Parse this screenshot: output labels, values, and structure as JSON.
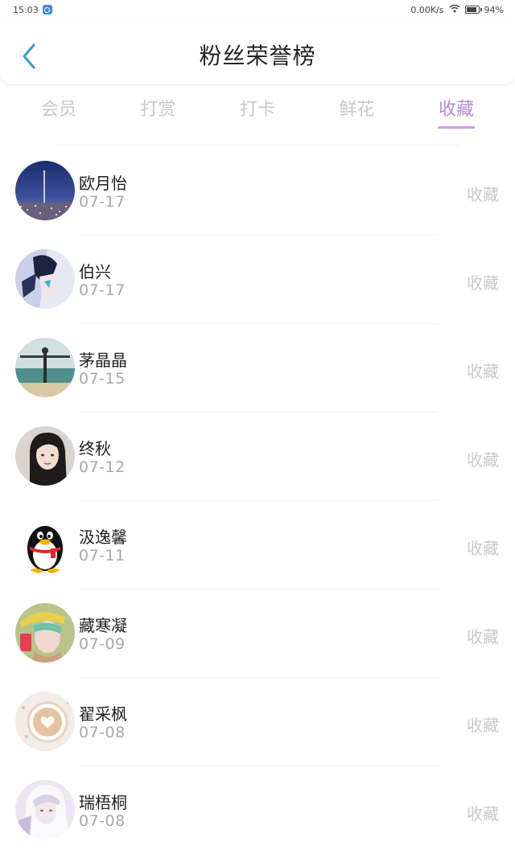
{
  "status_bar": {
    "time": "15:03",
    "network_speed": "0.00K/s",
    "battery_percent": "94%"
  },
  "header": {
    "title": "粉丝荣誉榜",
    "back_icon": "chevron-left-icon"
  },
  "tabs": [
    {
      "label": "会员",
      "active": false
    },
    {
      "label": "打赏",
      "active": false
    },
    {
      "label": "打卡",
      "active": false
    },
    {
      "label": "鲜花",
      "active": false
    },
    {
      "label": "收藏",
      "active": true
    }
  ],
  "fans": [
    {
      "name": "欧月怡",
      "date": "07-17",
      "action": "收藏"
    },
    {
      "name": "伯兴",
      "date": "07-17",
      "action": "收藏"
    },
    {
      "name": "茅晶晶",
      "date": "07-15",
      "action": "收藏"
    },
    {
      "name": "终秋",
      "date": "07-12",
      "action": "收藏"
    },
    {
      "name": "汲逸馨",
      "date": "07-11",
      "action": "收藏"
    },
    {
      "name": "藏寒凝",
      "date": "07-09",
      "action": "收藏"
    },
    {
      "name": "翟采枫",
      "date": "07-08",
      "action": "收藏"
    },
    {
      "name": "瑞梧桐",
      "date": "07-08",
      "action": "收藏"
    }
  ],
  "colors": {
    "accent": "#b48ad9",
    "back_icon": "#3a9ad9",
    "inactive_tab": "#c8c8c8"
  }
}
